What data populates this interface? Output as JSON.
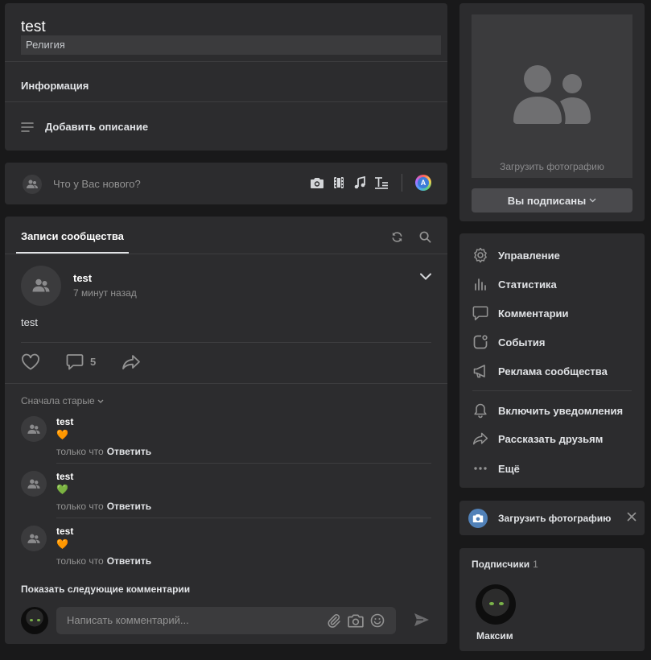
{
  "colors": {
    "background": "#19191a",
    "card": "#2c2c2e",
    "accent": "#5181b8",
    "muted": "#939393",
    "heart_orange": "#ff6a1a",
    "heart_green": "#2ecc40"
  },
  "header": {
    "title": "test",
    "status": "Религия",
    "info_label": "Информация",
    "add_description_label": "Добавить описание"
  },
  "composer": {
    "placeholder": "Что у Вас нового?",
    "ai_label": "A",
    "tools": [
      "camera-icon",
      "film-icon",
      "music-icon",
      "text-format-icon"
    ]
  },
  "wall": {
    "tab_label": "Записи сообщества",
    "post": {
      "author": "test",
      "time": "7 минут назад",
      "text": "test",
      "comments_count": "5"
    },
    "sort_label": "Сначала старые",
    "comments": [
      {
        "author": "test",
        "emoji": "🧡",
        "time": "только что",
        "reply": "Ответить"
      },
      {
        "author": "test",
        "emoji": "💚",
        "time": "только что",
        "reply": "Ответить"
      },
      {
        "author": "test",
        "emoji": "🧡",
        "time": "только что",
        "reply": "Ответить"
      }
    ],
    "show_more_label": "Показать следующие комментарии",
    "comment_placeholder": "Написать комментарий..."
  },
  "cover": {
    "upload_label": "Загрузить фотографию",
    "subscribed_label": "Вы подписаны"
  },
  "menu": {
    "items": [
      {
        "label": "Управление",
        "icon": "gear-icon"
      },
      {
        "label": "Статистика",
        "icon": "stats-icon"
      },
      {
        "label": "Комментарии",
        "icon": "comment-icon"
      },
      {
        "label": "События",
        "icon": "events-icon"
      },
      {
        "label": "Реклама сообщества",
        "icon": "megaphone-icon"
      },
      {
        "label": "Включить уведомления",
        "icon": "bell-icon"
      },
      {
        "label": "Рассказать друзьям",
        "icon": "share-icon"
      },
      {
        "label": "Ещё",
        "icon": "more-icon"
      }
    ]
  },
  "upload_photo": {
    "label": "Загрузить фотографию"
  },
  "subscribers": {
    "title": "Подписчики",
    "count": "1",
    "items": [
      {
        "name": "Максим"
      }
    ]
  }
}
